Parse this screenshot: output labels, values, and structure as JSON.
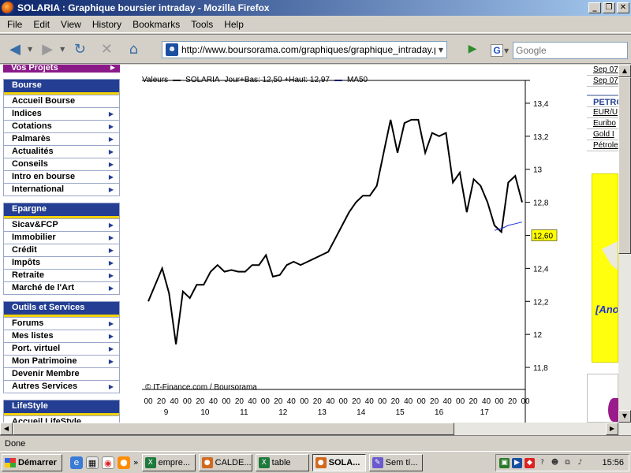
{
  "window": {
    "title": "SOLARIA : Graphique boursier intraday - Mozilla Firefox",
    "buttons": {
      "minimize": "_",
      "maximize": "❐",
      "close": "✕"
    }
  },
  "menu": [
    "File",
    "Edit",
    "View",
    "History",
    "Bookmarks",
    "Tools",
    "Help"
  ],
  "navbar": {
    "url": "http://www.boursorama.com/graphiques/graphique_intraday.phtml?s",
    "search_placeholder": "Google",
    "icons": {
      "back": "◀",
      "forward": "▶",
      "reload": "↻",
      "home": "⌂",
      "go": "▶",
      "engine": "G"
    }
  },
  "leftnav": {
    "top_tab": "Vos Projets",
    "sections": [
      {
        "title": "Bourse",
        "items": [
          "Accueil Bourse",
          "Indices",
          "Cotations",
          "Palmarès",
          "Actualités",
          "Conseils",
          "Intro en bourse",
          "International"
        ]
      },
      {
        "title": "Epargne",
        "items": [
          "Sicav&FCP",
          "Immobilier",
          "Crédit",
          "Impôts",
          "Retraite",
          "Marché de l'Art"
        ]
      },
      {
        "title": "Outils et Services",
        "items": [
          "Forums",
          "Mes listes",
          "Port. virtuel",
          "Mon Patrimoine",
          "Devenir Membre",
          "Autres Services"
        ]
      },
      {
        "title": "LifeStyle",
        "items": [
          "Accueil LifeStyle"
        ]
      }
    ]
  },
  "legend": {
    "prefix": "Valeurs",
    "series_name": "SOLARIA",
    "stats": "Jour+Bas: 12,50 +Haut: 12,97",
    "ma_label": "MA50"
  },
  "chart_data": {
    "type": "line",
    "credit": "© IT-Finance.com / Boursorama",
    "current_value_label": "12,60",
    "current_value": 12.6,
    "ylim": [
      11.7,
      13.5
    ],
    "yticks": [
      11.8,
      12.0,
      12.2,
      12.4,
      12.6,
      12.8,
      13.0,
      13.2,
      13.4
    ],
    "ytick_labels": [
      "11,8",
      "12",
      "12,2",
      "12,4",
      "12,6",
      "12,8",
      "13",
      "13,2",
      "13,4"
    ],
    "hour_labels": [
      "9",
      "10",
      "11",
      "12",
      "13",
      "14",
      "15",
      "16",
      "17"
    ],
    "minute_labels": [
      "00",
      "20",
      "40",
      "00",
      "20",
      "40",
      "00",
      "20",
      "40",
      "00",
      "20",
      "40",
      "00",
      "20",
      "40",
      "00",
      "20",
      "40",
      "00",
      "20",
      "40",
      "00",
      "20",
      "40",
      "00",
      "20",
      "40",
      "00",
      "20",
      "00"
    ],
    "series": [
      {
        "name": "SOLARIA",
        "color": "#000000",
        "values": [
          12.2,
          12.3,
          12.4,
          12.25,
          11.94,
          12.26,
          12.22,
          12.3,
          12.3,
          12.38,
          12.42,
          12.38,
          12.39,
          12.38,
          12.38,
          12.42,
          12.42,
          12.48,
          12.35,
          12.36,
          12.42,
          12.44,
          12.42,
          12.44,
          12.46,
          12.48,
          12.5,
          12.58,
          12.66,
          12.74,
          12.8,
          12.84,
          12.84,
          12.9,
          13.1,
          13.3,
          13.1,
          13.28,
          13.3,
          13.3,
          13.1,
          13.22,
          13.2,
          13.22,
          12.92,
          12.98,
          12.74,
          12.94,
          12.9,
          12.8,
          12.66,
          12.62,
          12.92,
          12.96,
          12.8
        ]
      },
      {
        "name": "MA50",
        "color": "#1c2fd6",
        "values": [
          12.63,
          12.64,
          12.66,
          12.67,
          12.68
        ]
      }
    ]
  },
  "rightcol": {
    "links_top": [
      "Sep 07",
      "Sep 07"
    ],
    "header": "PETRO",
    "links": [
      "EUR/U",
      "Euribo",
      "Gold I",
      "Pétrole"
    ],
    "ad_text": "[Ano"
  },
  "status": "Done",
  "taskbar": {
    "start": "Démarrer",
    "tasks": [
      "empre...",
      "CALDE...",
      "table",
      "SOLA...",
      "Sem tí..."
    ],
    "more": "»",
    "clock": "15:56"
  },
  "colors": {
    "nav_header": "#233e92",
    "accent_yellow": "#f2d20a",
    "purple": "#8b1a89",
    "price_tag": "#ffff00"
  }
}
